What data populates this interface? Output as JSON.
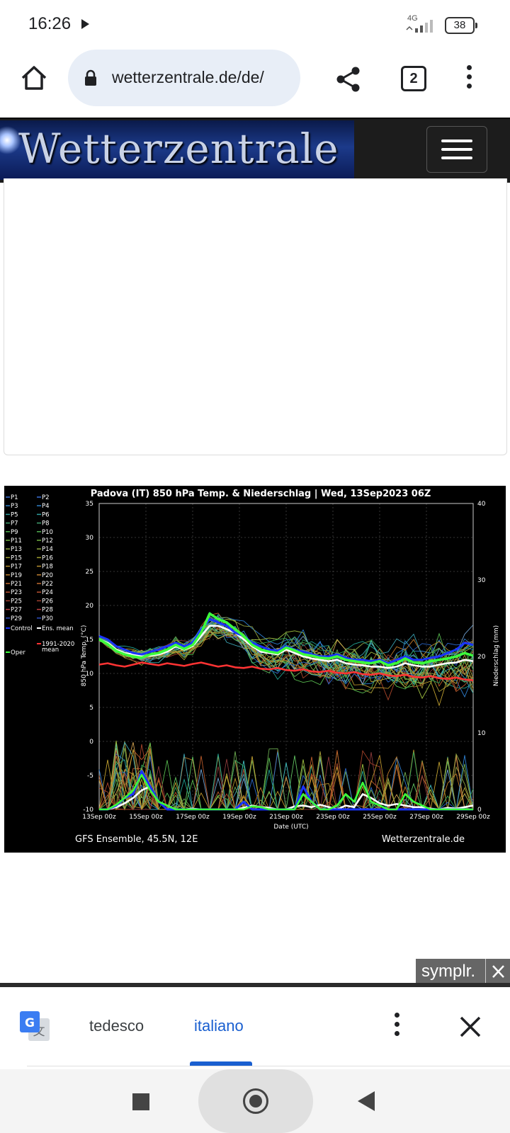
{
  "status_bar": {
    "time": "16:26",
    "network": "4G",
    "battery": "38",
    "icons": [
      "play-store-icon",
      "signal-icon",
      "battery-icon"
    ]
  },
  "browser": {
    "url": "wetterzentrale.de/de/",
    "tab_count": "2",
    "icons": [
      "home-icon",
      "lock-icon",
      "share-icon",
      "tabs-icon",
      "menu-icon"
    ]
  },
  "site": {
    "logo_text": "Wetterzentrale",
    "menu_icon": "hamburger-icon"
  },
  "chart_data": {
    "type": "line",
    "title": "Padova  (IT)  850 hPa Temp. & Niederschlag | Wed, 13Sep2023 06Z",
    "xlabel": "Date (UTC)",
    "ylabel": "850 hPa Temp. (°C)",
    "y2label": "Niederschlag (mm)",
    "ylim": [
      -10,
      35
    ],
    "y2lim": [
      0,
      40
    ],
    "yticks": [
      "35",
      "30",
      "25",
      "20",
      "15",
      "10",
      "5",
      "0",
      "-5",
      "-10"
    ],
    "y2ticks": [
      "40",
      "30",
      "20",
      "10",
      "0"
    ],
    "xticks": [
      "13Sep 00z",
      "15Sep 00z",
      "17Sep 00z",
      "19Sep 00z",
      "21Sep 00z",
      "23Sep 00z",
      "25Sep 00z",
      "27Sep 00z",
      "29Sep 00z"
    ],
    "legend": {
      "members": [
        "P1",
        "P2",
        "P3",
        "P4",
        "P5",
        "P6",
        "P7",
        "P8",
        "P9",
        "P10",
        "P11",
        "P12",
        "P13",
        "P14",
        "P15",
        "P16",
        "P17",
        "P18",
        "P19",
        "P20",
        "P21",
        "P22",
        "P23",
        "P24",
        "P25",
        "P26",
        "P27",
        "P28",
        "P29",
        "P30"
      ],
      "extra": [
        "Control",
        "Ens. mean",
        "1991-2020 mean",
        "Oper"
      ]
    },
    "source_left": "GFS Ensemble, 45.5N, 12E",
    "source_right": "Wetterzentrale.de",
    "series": [
      {
        "name": "Ens. mean",
        "color": "#ffffff",
        "values": [
          15,
          14.5,
          13.5,
          13,
          12.8,
          12.5,
          12.6,
          12.8,
          13.2,
          14,
          13.5,
          14,
          15.5,
          17,
          17,
          16.5,
          16,
          15,
          14,
          13.2,
          13,
          12.8,
          13.5,
          13,
          12.5,
          12.2,
          12,
          11.8,
          12,
          11.5,
          11.3,
          11.2,
          11,
          11,
          10.8,
          11,
          11.5,
          11.2,
          11,
          11,
          11.3,
          11.5,
          11.6,
          12,
          11.8
        ]
      },
      {
        "name": "Control",
        "color": "#1a33ff",
        "values": [
          15.5,
          15,
          14,
          13.5,
          13,
          12.8,
          13.2,
          13.5,
          14,
          14.5,
          14,
          14.5,
          16.5,
          18,
          17.5,
          17,
          16,
          15.5,
          14.5,
          14,
          13.5,
          13.3,
          14,
          13.5,
          13.2,
          12.8,
          12.5,
          12.5,
          12.8,
          12.3,
          12,
          12,
          11.8,
          12,
          11.5,
          12,
          12.5,
          12,
          12,
          12.3,
          12.5,
          13,
          13.5,
          14.5,
          14.2
        ]
      },
      {
        "name": "Oper",
        "color": "#3cff3c",
        "values": [
          15,
          14.3,
          13.3,
          12.8,
          12.5,
          12.3,
          12.8,
          13,
          13.5,
          14.2,
          13.6,
          14.2,
          16,
          18.8,
          18,
          17.5,
          16.5,
          15.5,
          14.2,
          13.5,
          13.2,
          13,
          13.8,
          13.4,
          12.8,
          12.6,
          12.3,
          12.2,
          12.5,
          12,
          11.8,
          11.6,
          11.5,
          11.8,
          11.2,
          11.5,
          12.2,
          11.6,
          11.5,
          11.8,
          12,
          12.2,
          12.5,
          13,
          12.6
        ]
      },
      {
        "name": "1991-2020 mean",
        "color": "#ff3333",
        "values": [
          11.3,
          11.5,
          11.2,
          11,
          11.3,
          11.6,
          11.4,
          11.2,
          11.5,
          11.3,
          11.1,
          11.4,
          11.6,
          11.3,
          11,
          11.2,
          10.9,
          10.8,
          11,
          10.7,
          10.6,
          10.8,
          10.5,
          10.4,
          10.6,
          10.3,
          10.2,
          10.4,
          10.1,
          10,
          10.2,
          9.9,
          9.8,
          10,
          9.7,
          9.6,
          9.8,
          9.5,
          9.4,
          9.6,
          9.3,
          9.2,
          9.4,
          9.1,
          9
        ]
      },
      {
        "name": "Ens. mean precip",
        "color": "#ffffff",
        "axis": "y2",
        "values": [
          0,
          0,
          0.3,
          0.8,
          1.5,
          2.5,
          3,
          1,
          0.5,
          0,
          0,
          0.1,
          0,
          0,
          0,
          0,
          0,
          0.2,
          0.5,
          0.3,
          0.2,
          0,
          0,
          0.4,
          0.5,
          0.3,
          0.6,
          0.3,
          0,
          0.5,
          0.3,
          2,
          1.5,
          0.8,
          0.5,
          0.7,
          0.5,
          0.3,
          0.3,
          0.1,
          0,
          0.2,
          0.1,
          0.3,
          0.5
        ]
      },
      {
        "name": "Control precip",
        "color": "#1a33ff",
        "axis": "y2",
        "values": [
          0,
          0,
          0.5,
          1.5,
          2,
          5,
          3,
          1,
          0,
          0,
          0,
          0,
          0,
          0,
          0,
          0,
          0,
          1,
          0,
          0,
          0,
          0,
          0,
          0,
          3,
          1,
          0,
          0,
          0,
          0,
          0,
          0,
          0,
          0,
          0,
          0,
          0,
          0,
          0,
          0,
          0,
          0,
          0,
          0,
          0
        ]
      },
      {
        "name": "Oper precip",
        "color": "#3cff3c",
        "axis": "y2",
        "values": [
          0,
          0,
          0.6,
          1.5,
          2.5,
          4.5,
          2.5,
          1,
          0.5,
          0,
          0,
          0,
          0,
          0,
          0,
          0,
          0,
          0,
          0.4,
          0.3,
          0,
          0,
          0,
          0,
          2,
          1,
          0,
          0,
          0.5,
          2,
          1,
          3.5,
          1,
          0.5,
          0,
          0,
          2,
          1,
          0.5,
          0,
          0,
          0,
          0,
          0,
          0
        ]
      }
    ]
  },
  "ad_tag": {
    "label": "symplr.",
    "close_icon": "close-icon"
  },
  "translate": {
    "source_lang": "tedesco",
    "target_lang": "italiano",
    "icons": [
      "google-translate-icon",
      "menu-icon",
      "close-icon"
    ]
  },
  "nav": {
    "icons": [
      "recents-icon",
      "home-icon",
      "back-icon"
    ]
  }
}
